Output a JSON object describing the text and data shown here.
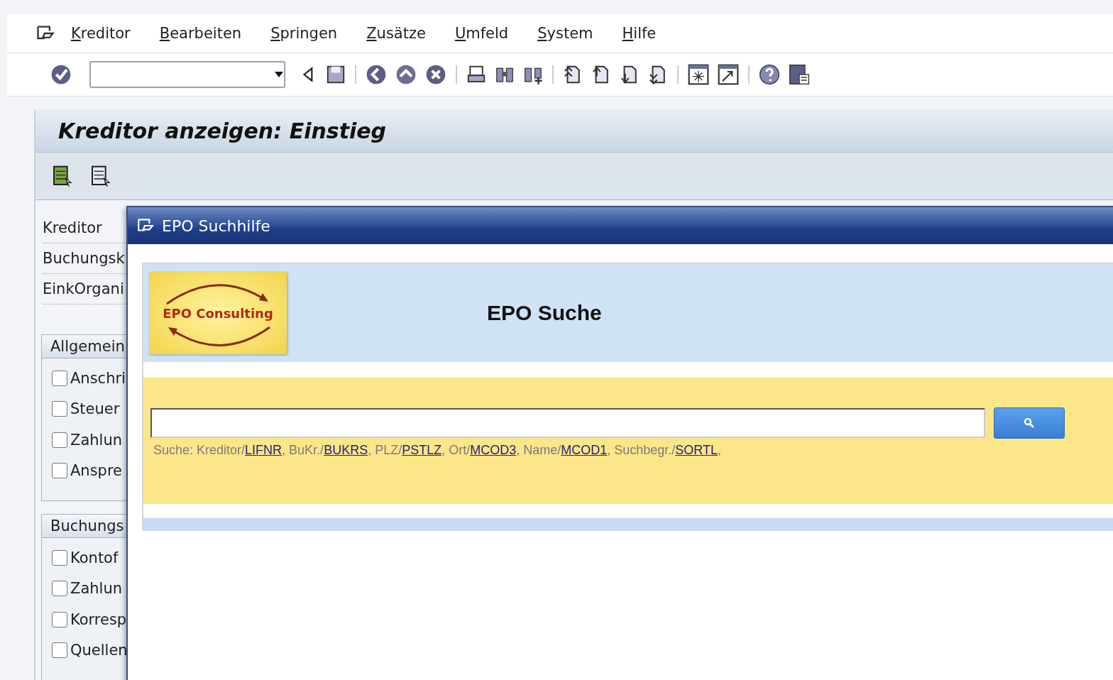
{
  "menu": [
    {
      "label": "Kreditor"
    },
    {
      "label": "Bearbeiten"
    },
    {
      "label": "Springen"
    },
    {
      "label": "Zusätze"
    },
    {
      "label": "Umfeld"
    },
    {
      "label": "System"
    },
    {
      "label": "Hilfe"
    }
  ],
  "screen_title": "Kreditor anzeigen: Einstieg",
  "fields": [
    {
      "label": "Kreditor"
    },
    {
      "label": "Buchungsk"
    },
    {
      "label": "EinkOrgani"
    }
  ],
  "groups": [
    {
      "title": "Allgemein",
      "items": [
        {
          "label": "Anschri",
          "checked": false
        },
        {
          "label": "Steuer",
          "checked": false
        },
        {
          "label": "Zahlun",
          "checked": false
        },
        {
          "label": "Anspre",
          "checked": false
        }
      ]
    },
    {
      "title": "Buchungs",
      "items": [
        {
          "label": "Kontof",
          "checked": false
        },
        {
          "label": "Zahlun",
          "checked": false
        },
        {
          "label": "Korresp",
          "checked": false
        },
        {
          "label": "Quellen",
          "checked": false
        }
      ]
    }
  ],
  "dialog": {
    "title": "EPO Suchhilfe",
    "logo_text": "EPO Consulting",
    "heading": "EPO Suche",
    "hint": [
      {
        "text": "Suche: Kreditor/",
        "link": "LIFNR"
      },
      {
        "text": ", BuKr./",
        "link": "BUKRS"
      },
      {
        "text": ", PLZ/",
        "link": "PSTLZ"
      },
      {
        "text": ", Ort/",
        "link": "MCOD3"
      },
      {
        "text": ", Name/",
        "link": "MCOD1"
      },
      {
        "text": ", Suchbegr./",
        "link": "SORTL"
      },
      {
        "text": ","
      }
    ]
  }
}
